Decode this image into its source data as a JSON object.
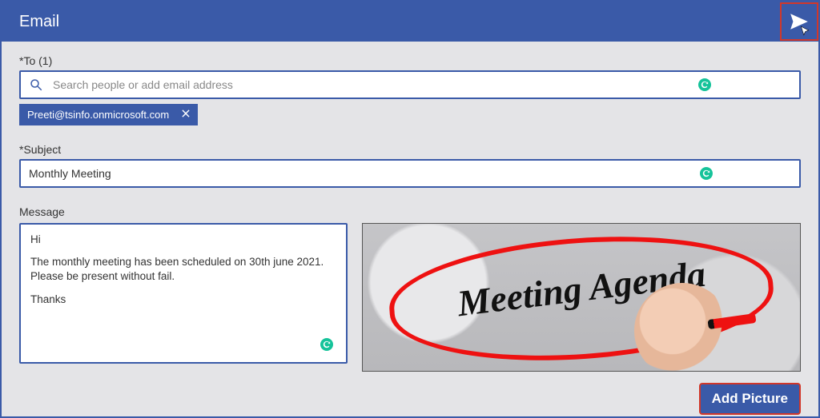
{
  "header": {
    "title": "Email"
  },
  "to": {
    "label": "*To (1)",
    "search_placeholder": "Search people or add email address",
    "recipients": [
      {
        "email": "Preeti@tsinfo.onmicrosoft.com"
      }
    ]
  },
  "subject": {
    "label": "*Subject",
    "value": "Monthly Meeting"
  },
  "message": {
    "label": "Message",
    "greeting": "Hi",
    "body": "The monthly meeting has been scheduled on 30th june 2021. Please be present without fail.",
    "signoff": "Thanks"
  },
  "attachment": {
    "caption": "Meeting Agenda"
  },
  "buttons": {
    "add_picture": "Add Picture"
  },
  "colors": {
    "primary": "#3a5aa8",
    "highlight_border": "#d1372a",
    "grammarly": "#15c39a"
  }
}
